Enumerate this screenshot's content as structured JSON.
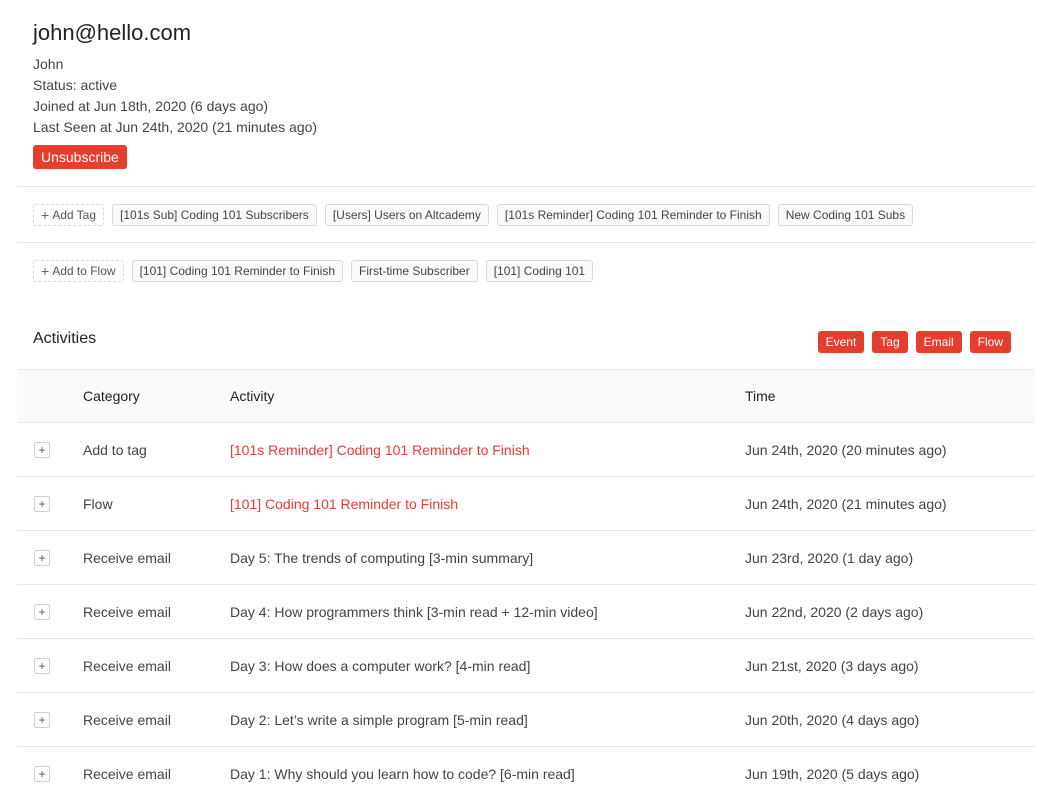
{
  "profile": {
    "email": "john@hello.com",
    "name": "John",
    "status": "Status: active",
    "joined": "Joined at Jun 18th, 2020 (6 days ago)",
    "last_seen": "Last Seen at Jun 24th, 2020 (21 minutes ago)",
    "unsubscribe_label": "Unsubscribe"
  },
  "tags": {
    "add_label": "Add Tag",
    "items": [
      "[101s Sub] Coding 101 Subscribers",
      "[Users] Users on Altcademy",
      "[101s Reminder] Coding 101 Reminder to Finish",
      "New Coding 101 Subs"
    ]
  },
  "flows": {
    "add_label": "Add to Flow",
    "items": [
      "[101] Coding 101 Reminder to Finish",
      "First-time Subscriber",
      "[101] Coding 101"
    ]
  },
  "activities": {
    "title": "Activities",
    "filters": [
      "Event",
      "Tag",
      "Email",
      "Flow"
    ],
    "columns": {
      "category": "Category",
      "activity": "Activity",
      "time": "Time"
    },
    "rows": [
      {
        "category": "Add to tag",
        "activity": "[101s Reminder] Coding 101 Reminder to Finish",
        "time": "Jun 24th, 2020 (20 minutes ago)"
      },
      {
        "category": "Flow",
        "activity": "[101] Coding 101 Reminder to Finish",
        "time": "Jun 24th, 2020 (21 minutes ago)"
      },
      {
        "category": "Receive email",
        "activity": "Day 5: The trends of computing [3-min summary]",
        "time": "Jun 23rd, 2020 (1 day ago)"
      },
      {
        "category": "Receive email",
        "activity": "Day 4: How programmers think [3-min read + 12-min video]",
        "time": "Jun 22nd, 2020 (2 days ago)"
      },
      {
        "category": "Receive email",
        "activity": "Day 3: How does a computer work? [4-min read]",
        "time": "Jun 21st, 2020 (3 days ago)"
      },
      {
        "category": "Receive email",
        "activity": "Day 2: Let’s write a simple program [5-min read]",
        "time": "Jun 20th, 2020 (4 days ago)"
      },
      {
        "category": "Receive email",
        "activity": "Day 1: Why should you learn how to code? [6-min read]",
        "time": "Jun 19th, 2020 (5 days ago)"
      }
    ]
  },
  "colors": {
    "accent": "#e53e2e",
    "border": "#e8e8e8",
    "header_bg": "#fafafa"
  }
}
